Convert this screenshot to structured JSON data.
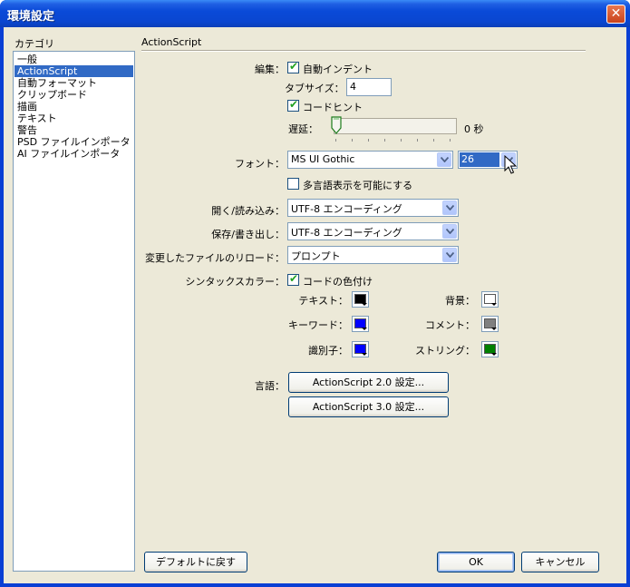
{
  "window": {
    "title": "環境設定",
    "close_glyph": "✕"
  },
  "categories": {
    "heading": "カテゴリ",
    "items": [
      "一般",
      "ActionScript",
      "自動フォーマット",
      "クリップボード",
      "描画",
      "テキスト",
      "警告",
      "PSD ファイルインポータ",
      "AI ファイルインポータ"
    ],
    "selected": "ActionScript"
  },
  "panel": {
    "title": "ActionScript",
    "edit": {
      "label": "編集：",
      "auto_indent_label": "自動インデント",
      "auto_indent_checked": true,
      "tab_size_label": "タブサイズ：",
      "tab_size_value": "4",
      "code_hint_label": "コードヒント",
      "code_hint_checked": true,
      "delay_label": "遅延：",
      "delay_value": "0 秒"
    },
    "font": {
      "label": "フォント：",
      "family": "MS UI Gothic",
      "size": "26",
      "multilang_label": "多言語表示を可能にする",
      "multilang_checked": false
    },
    "open_import": {
      "label": "開く/読み込み：",
      "value": "UTF-8 エンコーディング"
    },
    "save_export": {
      "label": "保存/書き出し：",
      "value": "UTF-8 エンコーディング"
    },
    "reload": {
      "label": "変更したファイルのリロード：",
      "value": "プロンプト"
    },
    "syntax": {
      "label": "シンタックスカラー：",
      "colorize_label": "コードの色付け",
      "colorize_checked": true,
      "text_label": "テキスト：",
      "text_color": "#000000",
      "background_label": "背景：",
      "background_color": "#ffffff",
      "keyword_label": "キーワード：",
      "keyword_color": "#0000ff",
      "comment_label": "コメント：",
      "comment_color": "#808080",
      "identifier_label": "識別子：",
      "identifier_color": "#0000ff",
      "string_label": "ストリング：",
      "string_color": "#008000"
    },
    "language": {
      "label": "言語：",
      "as2_button": "ActionScript 2.0 設定...",
      "as3_button": "ActionScript 3.0 設定..."
    }
  },
  "footer": {
    "reset_button": "デフォルトに戻す",
    "ok_button": "OK",
    "cancel_button": "キャンセル"
  },
  "colors": {
    "title_bar": "#0a4ad8",
    "dialog_bg": "#ece9d8",
    "selection": "#316ac5"
  },
  "icons": {
    "close": "close-icon",
    "dropdown": "chevron-down-icon",
    "cursor": "mouse-pointer-icon"
  }
}
